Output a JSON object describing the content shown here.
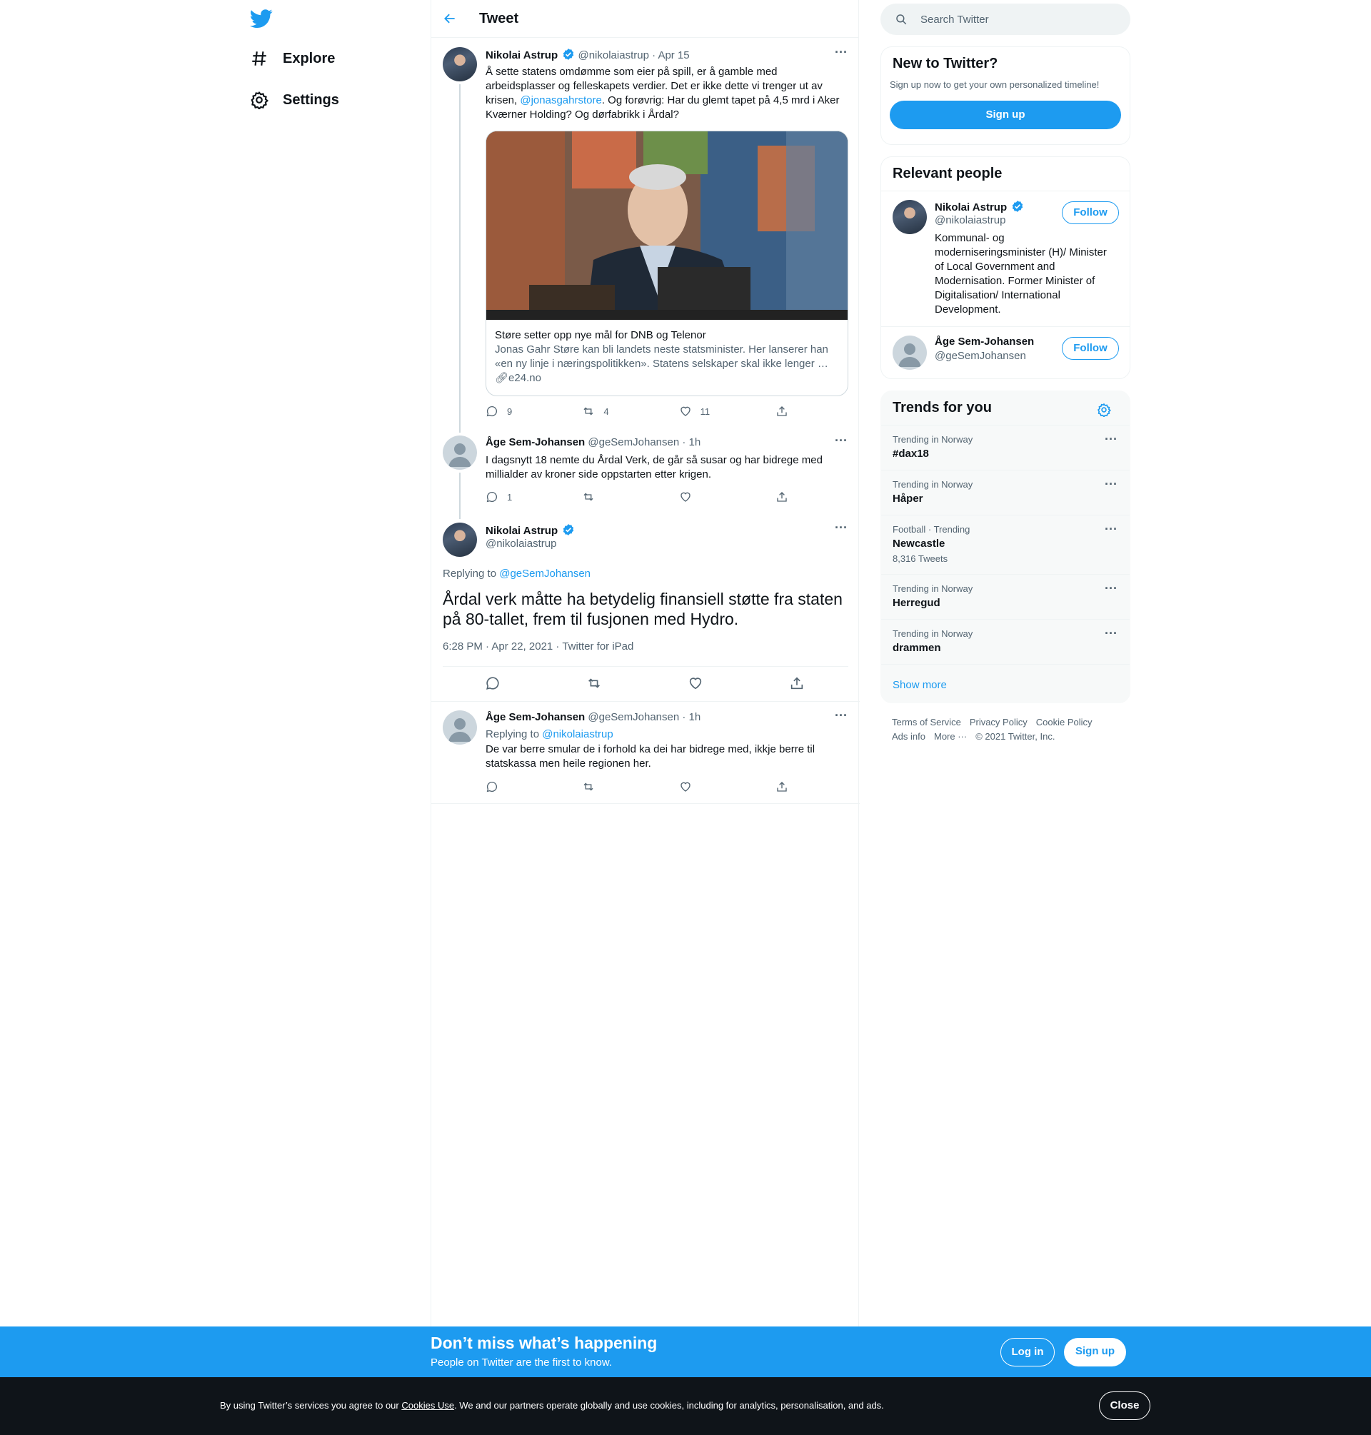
{
  "nav": {
    "explore": "Explore",
    "settings": "Settings"
  },
  "header": {
    "title": "Tweet"
  },
  "tweets": [
    {
      "name": "Nikolai Astrup",
      "handle": "@nikolaiastrup",
      "time": "· Apr 15",
      "text_before": "Å sette statens omdømme som eier på spill, er å gamble med arbeidsplasser og felleskapets verdier. Det er ikke dette vi trenger ut av krisen, ",
      "mention": "@jonasgahrstore",
      "text_after": ". Og forøvrig: Har du glemt tapet på 4,5 mrd i Aker Kværner Holding? Og dørfabrikk i Årdal?",
      "card": {
        "title": "Støre setter opp nye mål for DNB og Telenor",
        "desc": "Jonas Gahr Støre kan bli landets neste statsminister. Her lanserer han «en ny linje i næringspolitikken». Statens selskaper skal ikke lenger …",
        "link": "e24.no"
      },
      "replies": "9",
      "retweets": "4",
      "likes": "11"
    },
    {
      "name": "Åge Sem-Johansen",
      "handle": "@geSemJohansen",
      "time": "· 1h",
      "text": "I dagsnytt 18 nemte du Årdal Verk, de går så susar og har bidrege med millialder av kroner side oppstarten etter krigen.",
      "replies": "1",
      "retweets": "",
      "likes": ""
    }
  ],
  "main_tweet": {
    "name": "Nikolai Astrup",
    "handle": "@nikolaiastrup",
    "replying_prefix": "Replying to",
    "replying_to": "@geSemJohansen",
    "text": "Årdal verk måtte ha betydelig finansiell støtte fra staten på 80-tallet, frem til fusjonen med Hydro.",
    "meta": "6:28 PM · Apr 22, 2021 · Twitter for iPad"
  },
  "reply_tweet": {
    "name": "Åge Sem-Johansen",
    "handle": "@geSemJohansen",
    "time": "· 1h",
    "replying_prefix": "Replying to",
    "replying_to": "@nikolaiastrup",
    "text": "De var berre smular de i forhold ka dei har bidrege med, ikkje berre til statskassa men heile regionen her."
  },
  "search": {
    "placeholder": "Search Twitter"
  },
  "new_to_twitter": {
    "title": "New to Twitter?",
    "subtitle": "Sign up now to get your own personalized timeline!",
    "button": "Sign up"
  },
  "relevant_people": {
    "title": "Relevant people",
    "people": [
      {
        "name": "Nikolai Astrup",
        "handle": "@nikolaiastrup",
        "bio": "Kommunal- og moderniseringsminister (H)/ Minister of Local Government and Modernisation. Former Minister of Digitalisation/ International Development.",
        "button": "Follow"
      },
      {
        "name": "Åge Sem-Johansen",
        "handle": "@geSemJohansen",
        "button": "Follow"
      }
    ]
  },
  "trends": {
    "title": "Trends for you",
    "items": [
      {
        "context": "Trending in Norway",
        "name": "#dax18",
        "count": ""
      },
      {
        "context": "Trending in Norway",
        "name": "Håper",
        "count": ""
      },
      {
        "context": "Football · Trending",
        "name": "Newcastle",
        "count": "8,316 Tweets"
      },
      {
        "context": "Trending in Norway",
        "name": "Herregud",
        "count": ""
      },
      {
        "context": "Trending in Norway",
        "name": "drammen",
        "count": ""
      }
    ],
    "show_more": "Show more"
  },
  "footer": {
    "terms": "Terms of Service",
    "privacy": "Privacy Policy",
    "cookie": "Cookie Policy",
    "ads": "Ads info",
    "more": "More ···",
    "copyright": "© 2021 Twitter, Inc."
  },
  "banner": {
    "title": "Don’t miss what’s happening",
    "subtitle": "People on Twitter are the first to know.",
    "login": "Log in",
    "signup": "Sign up"
  },
  "cookie_bar": {
    "prefix": "By using Twitter’s services you agree to our ",
    "link": "Cookies Use",
    "suffix": ". We and our partners operate globally and use cookies, including for analytics, personalisation, and ads.",
    "close": "Close"
  },
  "colors": {
    "accent": "#1d9bf0",
    "text": "#0f1419",
    "secondary": "#536471",
    "banner": "#1d9bf0",
    "cookie_bg": "#0f1419"
  }
}
